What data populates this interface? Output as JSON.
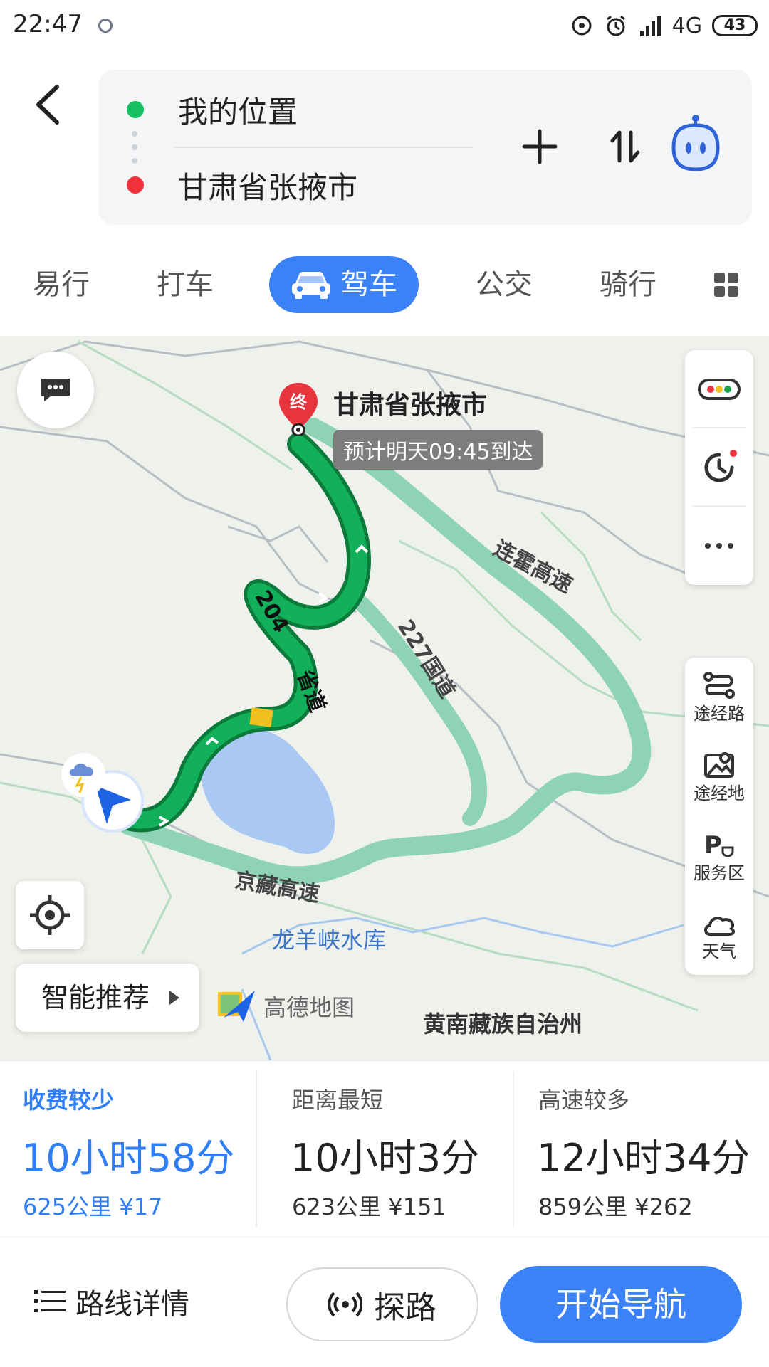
{
  "status_bar": {
    "time": "22:47",
    "network": "4G",
    "battery": "43",
    "icons": [
      "hotspot-icon",
      "alarm-icon",
      "signal-icon"
    ]
  },
  "search": {
    "start": "我的位置",
    "destination": "甘肃省张掖市"
  },
  "tabs": [
    {
      "label": "易行",
      "active": false
    },
    {
      "label": "打车",
      "active": false
    },
    {
      "label": "驾车",
      "active": true
    },
    {
      "label": "公交",
      "active": false
    },
    {
      "label": "骑行",
      "active": false
    }
  ],
  "map": {
    "destination_marker": "终",
    "destination_name": "甘肃省张掖市",
    "eta": "预计明天09:45到达",
    "labels": {
      "lianhuo": "连霍高速",
      "g227": "227国道",
      "s204_num": "204",
      "s204_name": "省道",
      "jingzang": "京藏高速",
      "reservoir": "龙羊峡水库",
      "huangnan": "黄南藏族自治州"
    },
    "recommend": "智能推荐",
    "logo_text": "高德地图",
    "side_tools": [
      {
        "label": "途经路",
        "icon": "route-via-icon"
      },
      {
        "label": "途经地",
        "icon": "map-pin-icon"
      },
      {
        "label": "服务区",
        "icon": "service-area-icon"
      },
      {
        "label": "天气",
        "icon": "cloud-icon"
      }
    ]
  },
  "route_options": [
    {
      "tag": "收费较少",
      "time": "10小时58分",
      "meta": "625公里 ¥17",
      "selected": true
    },
    {
      "tag": "距离最短",
      "time": "10小时3分",
      "meta": "623公里 ¥151",
      "selected": false
    },
    {
      "tag": "高速较多",
      "time": "12小时34分",
      "meta": "859公里 ¥262",
      "selected": false
    }
  ],
  "bottom": {
    "details": "路线详情",
    "probe": "探路",
    "navigate": "开始导航"
  },
  "colors": {
    "accent": "#3b82f6",
    "route_main": "#16a34a",
    "route_alt": "#8fd3b6",
    "start_dot": "#16c060",
    "end_dot": "#f0333c"
  }
}
